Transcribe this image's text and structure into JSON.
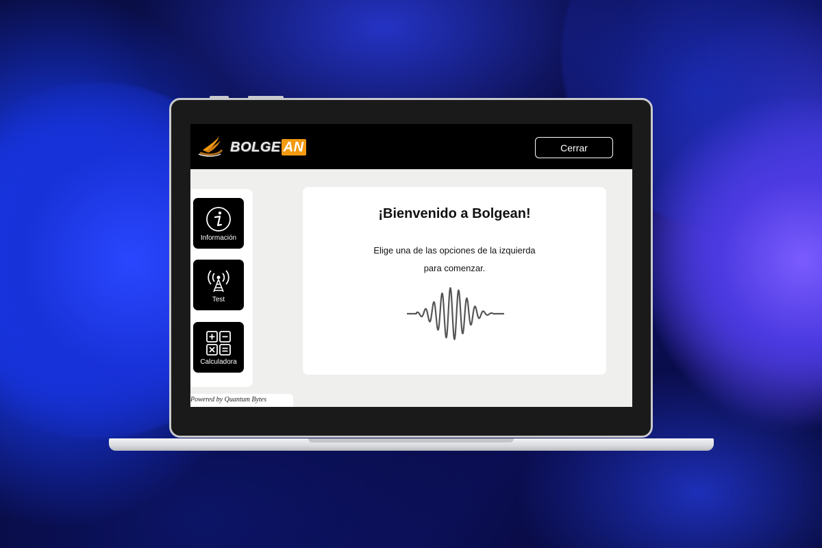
{
  "app": {
    "logo_part1": "BOLGE",
    "logo_part2": "AN",
    "close_label": "Cerrar"
  },
  "sidebar": {
    "items": [
      {
        "label": "Información",
        "icon": "info-icon"
      },
      {
        "label": "Test",
        "icon": "antenna-icon"
      },
      {
        "label": "Calculadora",
        "icon": "calculator-icon"
      }
    ]
  },
  "footer": {
    "powered_by": "Powered by Quantum Bytes"
  },
  "main": {
    "title": "¡Bienvenido a Bolgean!",
    "line1": "Elige una de las opciones de la izquierda",
    "line2": "para comenzar.",
    "illustration": "sound-wave-icon"
  },
  "colors": {
    "accent": "#f39a12",
    "header_bg": "#000000",
    "content_bg": "#efefed"
  }
}
